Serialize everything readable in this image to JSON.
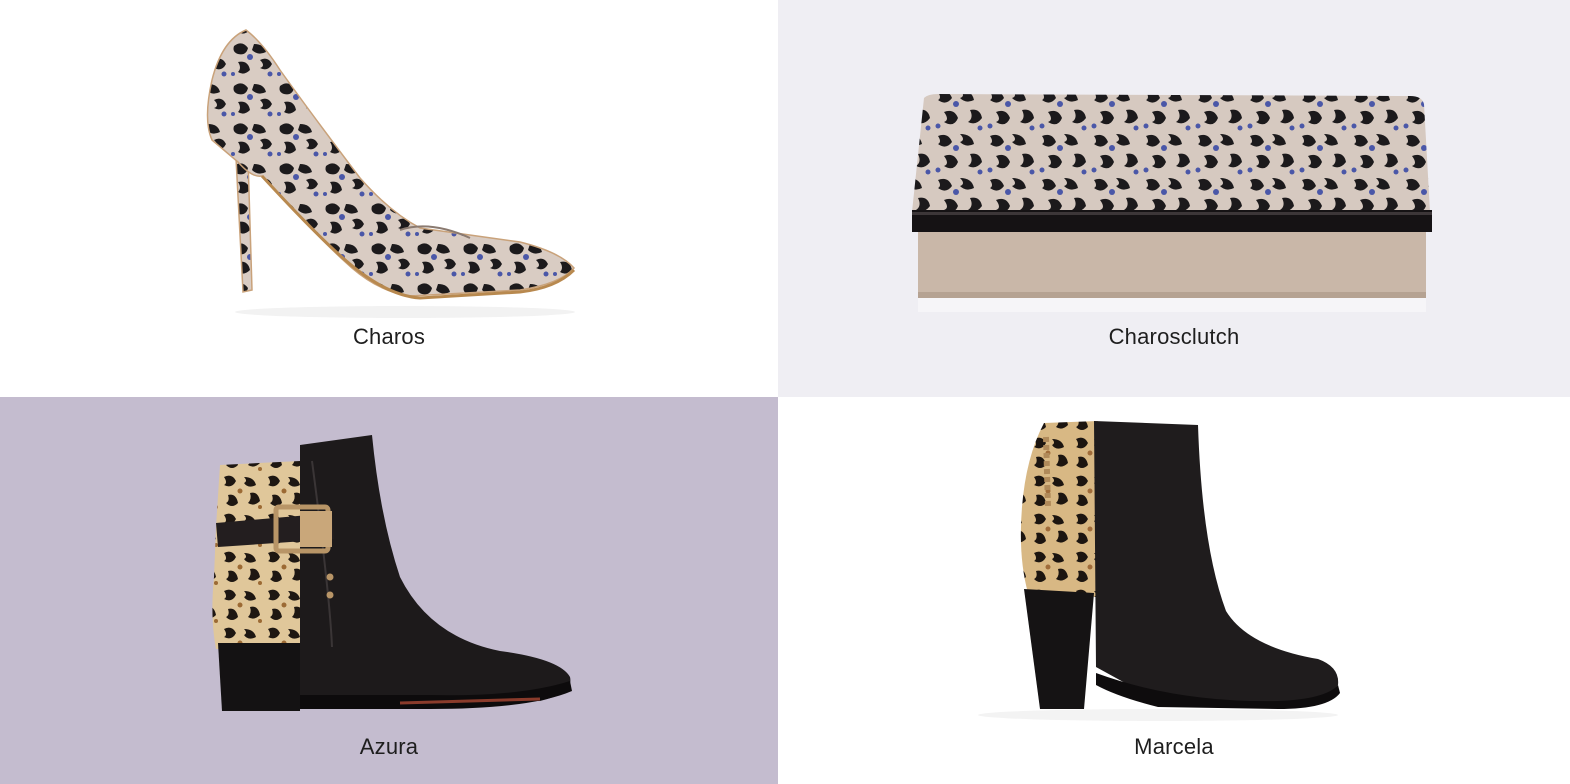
{
  "products": [
    {
      "name": "Charos",
      "background": "#ffffff",
      "image": "leopard-print-pump-image"
    },
    {
      "name": "Charosclutch",
      "background": "#efeef3",
      "image": "leopard-print-clutch-image"
    },
    {
      "name": "Azura",
      "background": "#c4bccf",
      "image": "leopard-panel-block-heel-ankle-boot-image"
    },
    {
      "name": "Marcela",
      "background": "#ffffff",
      "image": "leopard-panel-high-heel-ankle-boot-image"
    }
  ]
}
